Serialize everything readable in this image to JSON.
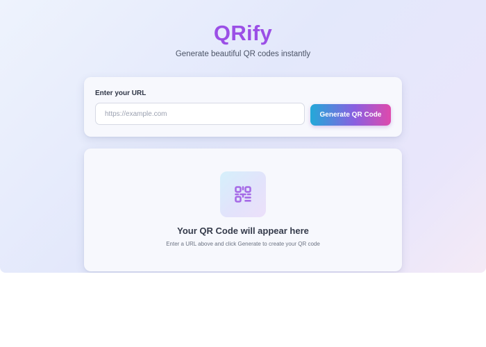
{
  "header": {
    "title": "QRify",
    "subtitle": "Generate beautiful QR codes instantly"
  },
  "input_card": {
    "label": "Enter your URL",
    "url_value": "",
    "url_placeholder": "https://example.com",
    "generate_label": "Generate QR Code"
  },
  "output_card": {
    "icon": "qr-code-icon",
    "empty_title": "Your QR Code will appear here",
    "empty_subtitle": "Enter a URL above and click Generate to create your QR code"
  },
  "colors": {
    "brand": "#9b4fe6",
    "button_gradient_start": "#23a9d8",
    "button_gradient_end": "#df4aac",
    "icon": "#a56ae6"
  }
}
